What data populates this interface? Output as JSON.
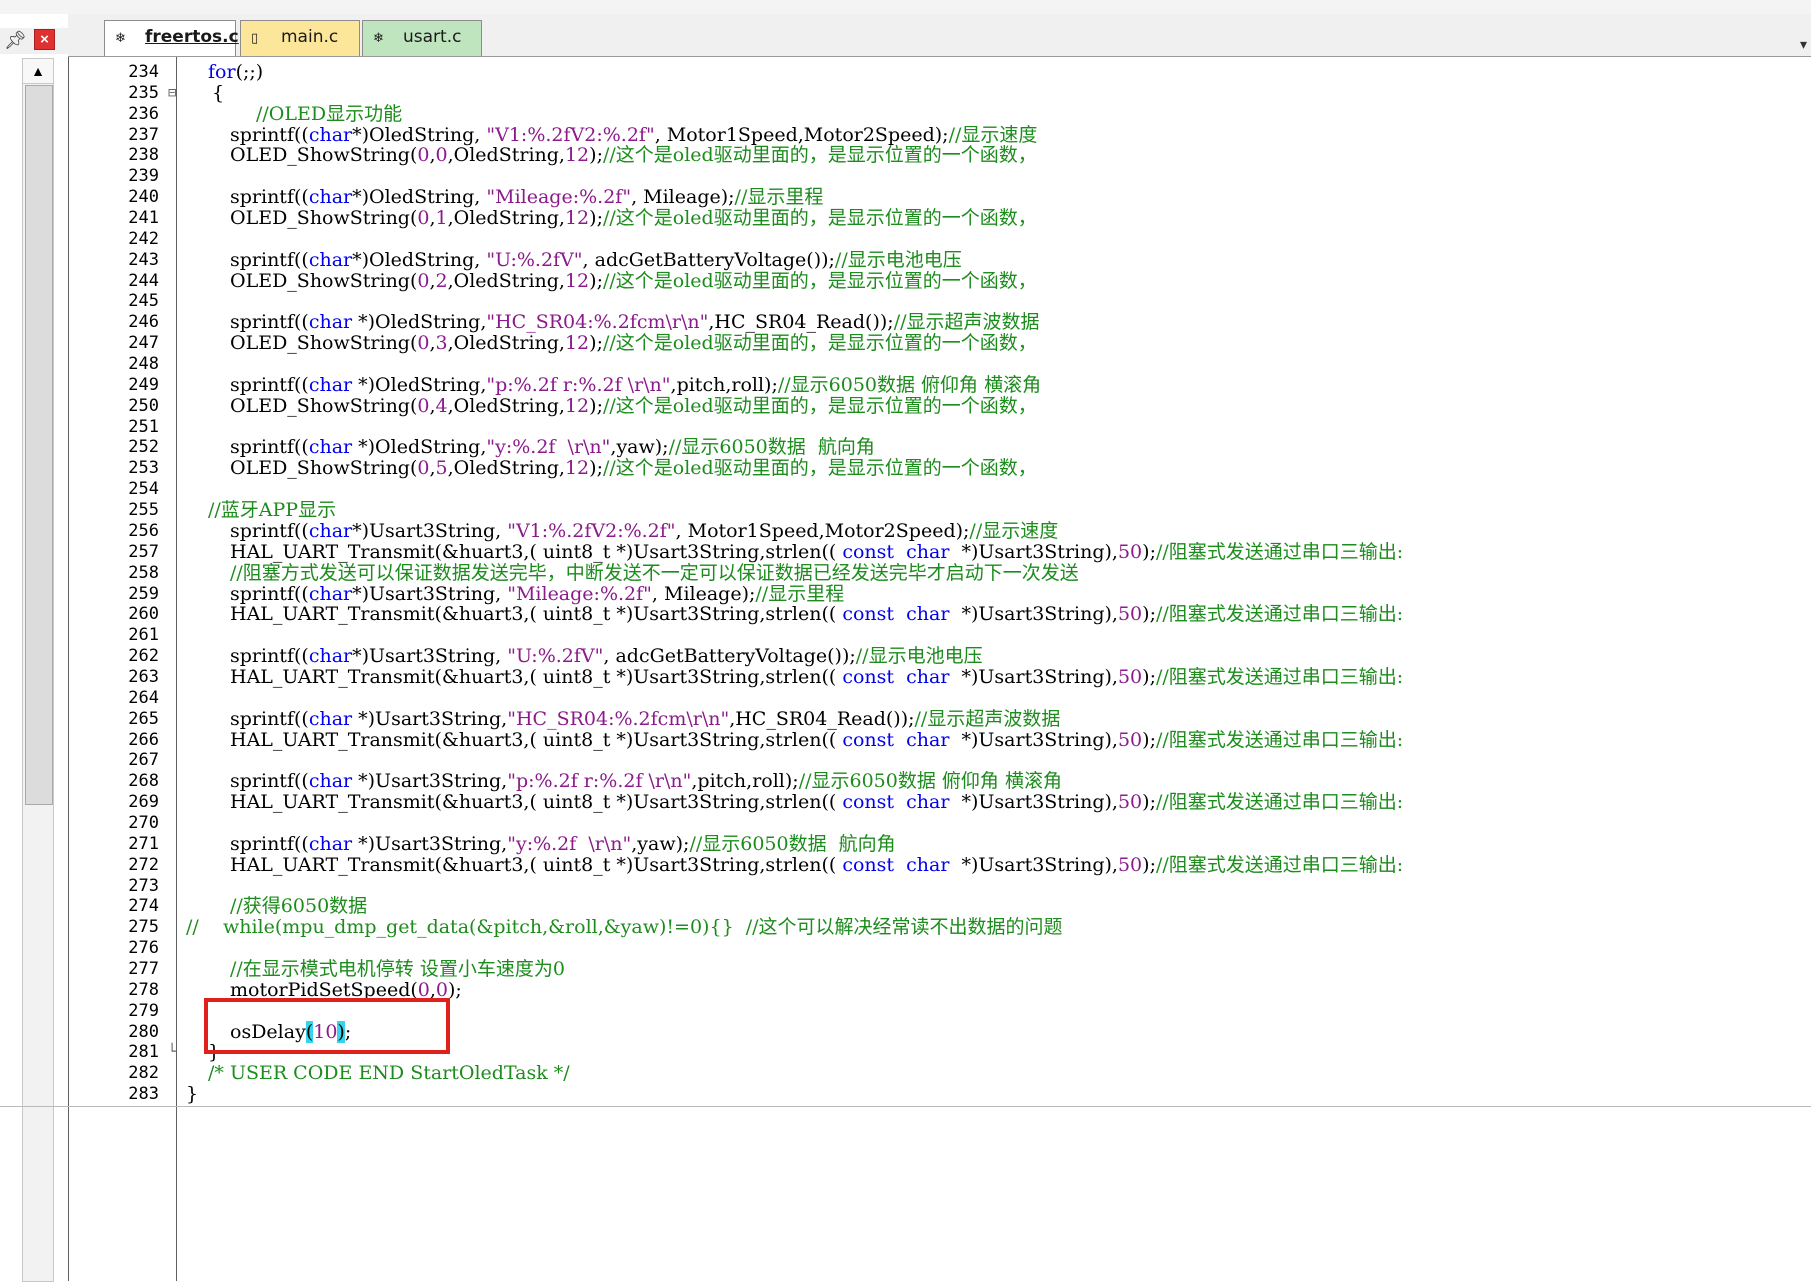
{
  "tabs": [
    {
      "label": "freertos.c",
      "active": true,
      "icon": "c-source-file-icon"
    },
    {
      "label": "main.c",
      "active": false,
      "icon": "file-icon"
    },
    {
      "label": "usart.c",
      "active": false,
      "icon": "c-source-file-icon"
    }
  ],
  "panel": {
    "pin_icon": "pin-icon",
    "close_icon": "close-icon"
  },
  "colors": {
    "keyword": "#0000ee",
    "string": "#8b1a8b",
    "comment": "#1c8c1c",
    "highlight_box": "#e0201c",
    "bracket_match": "#34d3ee"
  },
  "code_lines": [
    {
      "ln": "234",
      "indent": 140,
      "fold": "",
      "tokens": [
        [
          "kw",
          "for"
        ],
        [
          "pl",
          "(;;)"
        ]
      ]
    },
    {
      "ln": "235",
      "indent": 144,
      "fold": "⊟",
      "tokens": [
        [
          "pl",
          "{"
        ]
      ]
    },
    {
      "ln": "236",
      "indent": 188,
      "fold": "",
      "tokens": [
        [
          "cmt",
          "//OLED显示功能"
        ]
      ]
    },
    {
      "ln": "237",
      "indent": 162,
      "fold": "",
      "tokens": [
        [
          "pl",
          "sprintf(("
        ],
        [
          "kw",
          "char"
        ],
        [
          "pl",
          "*)OledString, "
        ],
        [
          "str",
          "\"V1:%.2fV2:%.2f\""
        ],
        [
          "pl",
          ", Motor1Speed,Motor2Speed);"
        ],
        [
          "cmt",
          "//显示速度"
        ]
      ]
    },
    {
      "ln": "238",
      "indent": 162,
      "fold": "",
      "tokens": [
        [
          "pl",
          "OLED_ShowString("
        ],
        [
          "num",
          "0"
        ],
        [
          "pl",
          ","
        ],
        [
          "num",
          "0"
        ],
        [
          "pl",
          ",OledString,"
        ],
        [
          "num",
          "12"
        ],
        [
          "pl",
          ");"
        ],
        [
          "cmt",
          "//这个是oled驱动里面的，是显示位置的一个函数，"
        ]
      ]
    },
    {
      "ln": "239",
      "indent": 162,
      "fold": "",
      "tokens": []
    },
    {
      "ln": "240",
      "indent": 162,
      "fold": "",
      "tokens": [
        [
          "pl",
          "sprintf(("
        ],
        [
          "kw",
          "char"
        ],
        [
          "pl",
          "*)OledString, "
        ],
        [
          "str",
          "\"Mileage:%.2f\""
        ],
        [
          "pl",
          ", Mileage);"
        ],
        [
          "cmt",
          "//显示里程"
        ]
      ]
    },
    {
      "ln": "241",
      "indent": 162,
      "fold": "",
      "tokens": [
        [
          "pl",
          "OLED_ShowString("
        ],
        [
          "num",
          "0"
        ],
        [
          "pl",
          ","
        ],
        [
          "num",
          "1"
        ],
        [
          "pl",
          ",OledString,"
        ],
        [
          "num",
          "12"
        ],
        [
          "pl",
          ");"
        ],
        [
          "cmt",
          "//这个是oled驱动里面的，是显示位置的一个函数，"
        ]
      ]
    },
    {
      "ln": "242",
      "indent": 162,
      "fold": "",
      "tokens": []
    },
    {
      "ln": "243",
      "indent": 162,
      "fold": "",
      "tokens": [
        [
          "pl",
          "sprintf(("
        ],
        [
          "kw",
          "char"
        ],
        [
          "pl",
          "*)OledString, "
        ],
        [
          "str",
          "\"U:%.2fV\""
        ],
        [
          "pl",
          ", adcGetBatteryVoltage());"
        ],
        [
          "cmt",
          "//显示电池电压"
        ]
      ]
    },
    {
      "ln": "244",
      "indent": 162,
      "fold": "",
      "tokens": [
        [
          "pl",
          "OLED_ShowString("
        ],
        [
          "num",
          "0"
        ],
        [
          "pl",
          ","
        ],
        [
          "num",
          "2"
        ],
        [
          "pl",
          ",OledString,"
        ],
        [
          "num",
          "12"
        ],
        [
          "pl",
          ");"
        ],
        [
          "cmt",
          "//这个是oled驱动里面的，是显示位置的一个函数，"
        ]
      ]
    },
    {
      "ln": "245",
      "indent": 162,
      "fold": "",
      "tokens": []
    },
    {
      "ln": "246",
      "indent": 162,
      "fold": "",
      "tokens": [
        [
          "pl",
          "sprintf(("
        ],
        [
          "kw",
          "char"
        ],
        [
          "pl",
          " *)OledString,"
        ],
        [
          "str",
          "\"HC_SR04:%.2fcm\\r\\n\""
        ],
        [
          "pl",
          ",HC_SR04_Read());"
        ],
        [
          "cmt",
          "//显示超声波数据"
        ]
      ]
    },
    {
      "ln": "247",
      "indent": 162,
      "fold": "",
      "tokens": [
        [
          "pl",
          "OLED_ShowString("
        ],
        [
          "num",
          "0"
        ],
        [
          "pl",
          ","
        ],
        [
          "num",
          "3"
        ],
        [
          "pl",
          ",OledString,"
        ],
        [
          "num",
          "12"
        ],
        [
          "pl",
          ");"
        ],
        [
          "cmt",
          "//这个是oled驱动里面的，是显示位置的一个函数，"
        ]
      ]
    },
    {
      "ln": "248",
      "indent": 162,
      "fold": "",
      "tokens": []
    },
    {
      "ln": "249",
      "indent": 162,
      "fold": "",
      "tokens": [
        [
          "pl",
          "sprintf(("
        ],
        [
          "kw",
          "char"
        ],
        [
          "pl",
          " *)OledString,"
        ],
        [
          "str",
          "\"p:%.2f r:%.2f \\r\\n\""
        ],
        [
          "pl",
          ",pitch,roll);"
        ],
        [
          "cmt",
          "//显示6050数据 俯仰角 横滚角"
        ]
      ]
    },
    {
      "ln": "250",
      "indent": 162,
      "fold": "",
      "tokens": [
        [
          "pl",
          "OLED_ShowString("
        ],
        [
          "num",
          "0"
        ],
        [
          "pl",
          ","
        ],
        [
          "num",
          "4"
        ],
        [
          "pl",
          ",OledString,"
        ],
        [
          "num",
          "12"
        ],
        [
          "pl",
          ");"
        ],
        [
          "cmt",
          "//这个是oled驱动里面的，是显示位置的一个函数，"
        ]
      ]
    },
    {
      "ln": "251",
      "indent": 162,
      "fold": "",
      "tokens": []
    },
    {
      "ln": "252",
      "indent": 162,
      "fold": "",
      "tokens": [
        [
          "pl",
          "sprintf(("
        ],
        [
          "kw",
          "char"
        ],
        [
          "pl",
          " *)OledString,"
        ],
        [
          "str",
          "\"y:%.2f  \\r\\n\""
        ],
        [
          "pl",
          ",yaw);"
        ],
        [
          "cmt",
          "//显示6050数据  航向角"
        ]
      ]
    },
    {
      "ln": "253",
      "indent": 162,
      "fold": "",
      "tokens": [
        [
          "pl",
          "OLED_ShowString("
        ],
        [
          "num",
          "0"
        ],
        [
          "pl",
          ","
        ],
        [
          "num",
          "5"
        ],
        [
          "pl",
          ",OledString,"
        ],
        [
          "num",
          "12"
        ],
        [
          "pl",
          ");"
        ],
        [
          "cmt",
          "//这个是oled驱动里面的，是显示位置的一个函数，"
        ]
      ]
    },
    {
      "ln": "254",
      "indent": 162,
      "fold": "",
      "tokens": []
    },
    {
      "ln": "255",
      "indent": 140,
      "fold": "",
      "tokens": [
        [
          "cmt",
          "//蓝牙APP显示"
        ]
      ]
    },
    {
      "ln": "256",
      "indent": 162,
      "fold": "",
      "tokens": [
        [
          "pl",
          "sprintf(("
        ],
        [
          "kw",
          "char"
        ],
        [
          "pl",
          "*)Usart3String, "
        ],
        [
          "str",
          "\"V1:%.2fV2:%.2f\""
        ],
        [
          "pl",
          ", Motor1Speed,Motor2Speed);"
        ],
        [
          "cmt",
          "//显示速度"
        ]
      ]
    },
    {
      "ln": "257",
      "indent": 162,
      "fold": "",
      "tokens": [
        [
          "pl",
          "HAL_UART_Transmit(&huart3,( uint8_t *)Usart3String,strlen(( "
        ],
        [
          "kw",
          "const  char"
        ],
        [
          "pl",
          "  *)Usart3String),"
        ],
        [
          "num",
          "50"
        ],
        [
          "pl",
          ");"
        ],
        [
          "cmt",
          "//阻塞式发送通过串口三输出:"
        ]
      ]
    },
    {
      "ln": "258",
      "indent": 162,
      "fold": "",
      "tokens": [
        [
          "cmt",
          "//阻塞方式发送可以保证数据发送完毕，中断发送不一定可以保证数据已经发送完毕才启动下一次发送"
        ]
      ]
    },
    {
      "ln": "259",
      "indent": 162,
      "fold": "",
      "tokens": [
        [
          "pl",
          "sprintf(("
        ],
        [
          "kw",
          "char"
        ],
        [
          "pl",
          "*)Usart3String, "
        ],
        [
          "str",
          "\"Mileage:%.2f\""
        ],
        [
          "pl",
          ", Mileage);"
        ],
        [
          "cmt",
          "//显示里程"
        ]
      ]
    },
    {
      "ln": "260",
      "indent": 162,
      "fold": "",
      "tokens": [
        [
          "pl",
          "HAL_UART_Transmit(&huart3,( uint8_t *)Usart3String,strlen(( "
        ],
        [
          "kw",
          "const  char"
        ],
        [
          "pl",
          "  *)Usart3String),"
        ],
        [
          "num",
          "50"
        ],
        [
          "pl",
          ");"
        ],
        [
          "cmt",
          "//阻塞式发送通过串口三输出:"
        ]
      ]
    },
    {
      "ln": "261",
      "indent": 162,
      "fold": "",
      "tokens": []
    },
    {
      "ln": "262",
      "indent": 162,
      "fold": "",
      "tokens": [
        [
          "pl",
          "sprintf(("
        ],
        [
          "kw",
          "char"
        ],
        [
          "pl",
          "*)Usart3String, "
        ],
        [
          "str",
          "\"U:%.2fV\""
        ],
        [
          "pl",
          ", adcGetBatteryVoltage());"
        ],
        [
          "cmt",
          "//显示电池电压"
        ]
      ]
    },
    {
      "ln": "263",
      "indent": 162,
      "fold": "",
      "tokens": [
        [
          "pl",
          "HAL_UART_Transmit(&huart3,( uint8_t *)Usart3String,strlen(( "
        ],
        [
          "kw",
          "const  char"
        ],
        [
          "pl",
          "  *)Usart3String),"
        ],
        [
          "num",
          "50"
        ],
        [
          "pl",
          ");"
        ],
        [
          "cmt",
          "//阻塞式发送通过串口三输出:"
        ]
      ]
    },
    {
      "ln": "264",
      "indent": 162,
      "fold": "",
      "tokens": []
    },
    {
      "ln": "265",
      "indent": 162,
      "fold": "",
      "tokens": [
        [
          "pl",
          "sprintf(("
        ],
        [
          "kw",
          "char"
        ],
        [
          "pl",
          " *)Usart3String,"
        ],
        [
          "str",
          "\"HC_SR04:%.2fcm\\r\\n\""
        ],
        [
          "pl",
          ",HC_SR04_Read());"
        ],
        [
          "cmt",
          "//显示超声波数据"
        ]
      ]
    },
    {
      "ln": "266",
      "indent": 162,
      "fold": "",
      "tokens": [
        [
          "pl",
          "HAL_UART_Transmit(&huart3,( uint8_t *)Usart3String,strlen(( "
        ],
        [
          "kw",
          "const  char"
        ],
        [
          "pl",
          "  *)Usart3String),"
        ],
        [
          "num",
          "50"
        ],
        [
          "pl",
          ");"
        ],
        [
          "cmt",
          "//阻塞式发送通过串口三输出:"
        ]
      ]
    },
    {
      "ln": "267",
      "indent": 162,
      "fold": "",
      "tokens": []
    },
    {
      "ln": "268",
      "indent": 162,
      "fold": "",
      "tokens": [
        [
          "pl",
          "sprintf(("
        ],
        [
          "kw",
          "char"
        ],
        [
          "pl",
          " *)Usart3String,"
        ],
        [
          "str",
          "\"p:%.2f r:%.2f \\r\\n\""
        ],
        [
          "pl",
          ",pitch,roll);"
        ],
        [
          "cmt",
          "//显示6050数据 俯仰角 横滚角"
        ]
      ]
    },
    {
      "ln": "269",
      "indent": 162,
      "fold": "",
      "tokens": [
        [
          "pl",
          "HAL_UART_Transmit(&huart3,( uint8_t *)Usart3String,strlen(( "
        ],
        [
          "kw",
          "const  char"
        ],
        [
          "pl",
          "  *)Usart3String),"
        ],
        [
          "num",
          "50"
        ],
        [
          "pl",
          ");"
        ],
        [
          "cmt",
          "//阻塞式发送通过串口三输出:"
        ]
      ]
    },
    {
      "ln": "270",
      "indent": 162,
      "fold": "",
      "tokens": []
    },
    {
      "ln": "271",
      "indent": 162,
      "fold": "",
      "tokens": [
        [
          "pl",
          "sprintf(("
        ],
        [
          "kw",
          "char"
        ],
        [
          "pl",
          " *)Usart3String,"
        ],
        [
          "str",
          "\"y:%.2f  \\r\\n\""
        ],
        [
          "pl",
          ",yaw);"
        ],
        [
          "cmt",
          "//显示6050数据  航向角"
        ]
      ]
    },
    {
      "ln": "272",
      "indent": 162,
      "fold": "",
      "tokens": [
        [
          "pl",
          "HAL_UART_Transmit(&huart3,( uint8_t *)Usart3String,strlen(( "
        ],
        [
          "kw",
          "const  char"
        ],
        [
          "pl",
          "  *)Usart3String),"
        ],
        [
          "num",
          "50"
        ],
        [
          "pl",
          ");"
        ],
        [
          "cmt",
          "//阻塞式发送通过串口三输出:"
        ]
      ]
    },
    {
      "ln": "273",
      "indent": 162,
      "fold": "",
      "tokens": []
    },
    {
      "ln": "274",
      "indent": 162,
      "fold": "",
      "tokens": [
        [
          "cmt",
          "//获得6050数据"
        ]
      ]
    },
    {
      "ln": "275",
      "indent": 118,
      "fold": "",
      "tokens": [
        [
          "cmt",
          "//    while(mpu_dmp_get_data(&pitch,&roll,&yaw)!=0){}  //这个可以解决经常读不出数据的问题"
        ]
      ]
    },
    {
      "ln": "276",
      "indent": 162,
      "fold": "",
      "tokens": []
    },
    {
      "ln": "277",
      "indent": 162,
      "fold": "",
      "tokens": [
        [
          "cmt",
          "//在显示模式电机停转 设置小车速度为0"
        ]
      ]
    },
    {
      "ln": "278",
      "indent": 162,
      "fold": "",
      "tokens": [
        [
          "pl",
          "motorPidSetSpeed("
        ],
        [
          "num",
          "0"
        ],
        [
          "pl",
          ","
        ],
        [
          "num",
          "0"
        ],
        [
          "pl",
          ");"
        ]
      ]
    },
    {
      "ln": "279",
      "indent": 162,
      "fold": "",
      "tokens": []
    },
    {
      "ln": "280",
      "indent": 162,
      "fold": "",
      "tokens": [
        [
          "pl",
          "osDelay"
        ],
        [
          "br",
          "("
        ],
        [
          "num",
          "10"
        ],
        [
          "br",
          ")"
        ],
        [
          "pl",
          ";"
        ]
      ]
    },
    {
      "ln": "281",
      "indent": 140,
      "fold": "└",
      "tokens": [
        [
          "pl",
          "}"
        ]
      ]
    },
    {
      "ln": "282",
      "indent": 140,
      "fold": "",
      "tokens": [
        [
          "cmt",
          "/* USER CODE END StartOledTask */"
        ]
      ]
    },
    {
      "ln": "283",
      "indent": 118,
      "fold": "",
      "tokens": [
        [
          "pl",
          "}"
        ]
      ]
    }
  ]
}
